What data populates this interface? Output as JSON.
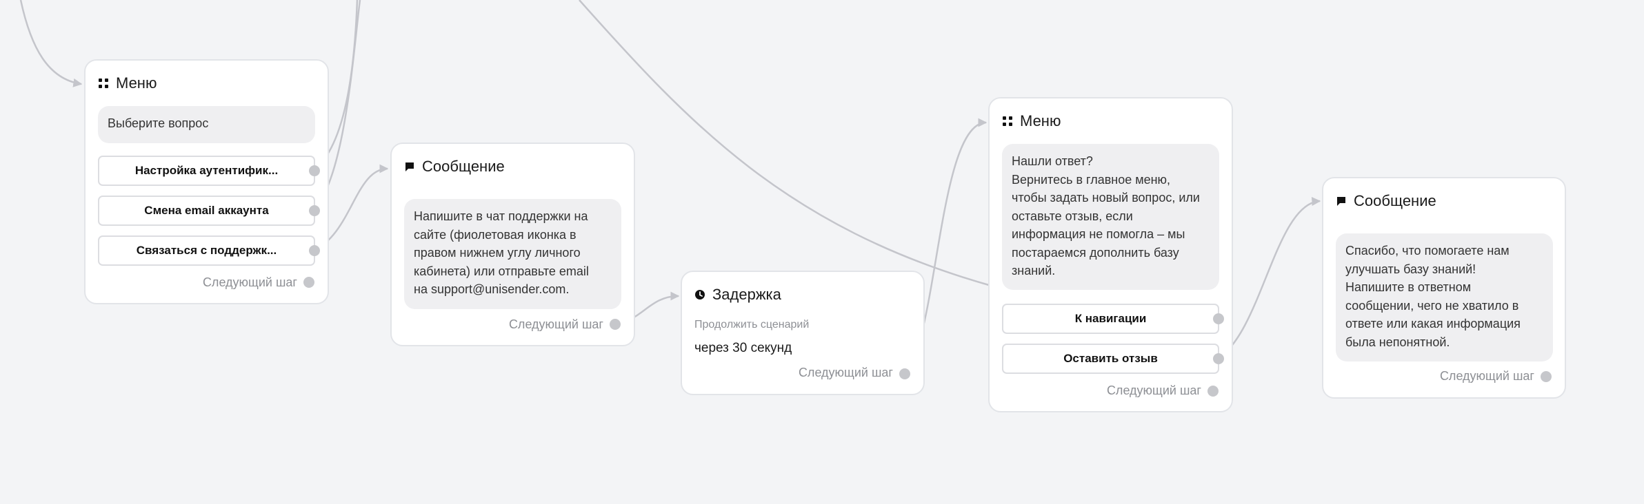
{
  "next_step_label": "Следующий шаг",
  "nodes": {
    "menu1": {
      "title": "Меню",
      "bubble": [
        "Выберите вопрос"
      ],
      "options": [
        "Настройка аутентифик...",
        "Смена email аккаунта",
        "Связаться с поддержк..."
      ]
    },
    "message1": {
      "title": "Сообщение",
      "bubble": [
        "Напишите в чат поддержки на",
        "сайте (фиолетовая иконка в",
        "правом нижнем углу личного",
        "кабинета) или отправьте email",
        "на support@unisender.com."
      ]
    },
    "delay": {
      "title": "Задержка",
      "label": "Продолжить сценарий",
      "value": "через 30 секунд"
    },
    "menu2": {
      "title": "Меню",
      "bubble": [
        "Нашли ответ?",
        "Вернитесь в главное меню,",
        "чтобы задать новый вопрос, или",
        "оставьте отзыв, если",
        "информация не помогла – мы",
        "постараемся дополнить базу",
        "знаний."
      ],
      "options": [
        "К навигации",
        "Оставить отзыв"
      ]
    },
    "message2": {
      "title": "Сообщение",
      "bubble": [
        "Спасибо, что помогаете нам",
        "улучшать базу знаний!",
        "Напишите в ответном",
        "сообщении, чего не хватило в",
        "ответе или какая информация",
        "была непонятной."
      ]
    }
  },
  "colors": {
    "edge": "#c4c5cb",
    "port": "#c6c7cb",
    "node_border": "#e2e4e8",
    "canvas": "#f3f4f6"
  },
  "icons": {
    "menu": "grid-icon",
    "message": "chat-bubble-icon",
    "delay": "clock-icon"
  }
}
